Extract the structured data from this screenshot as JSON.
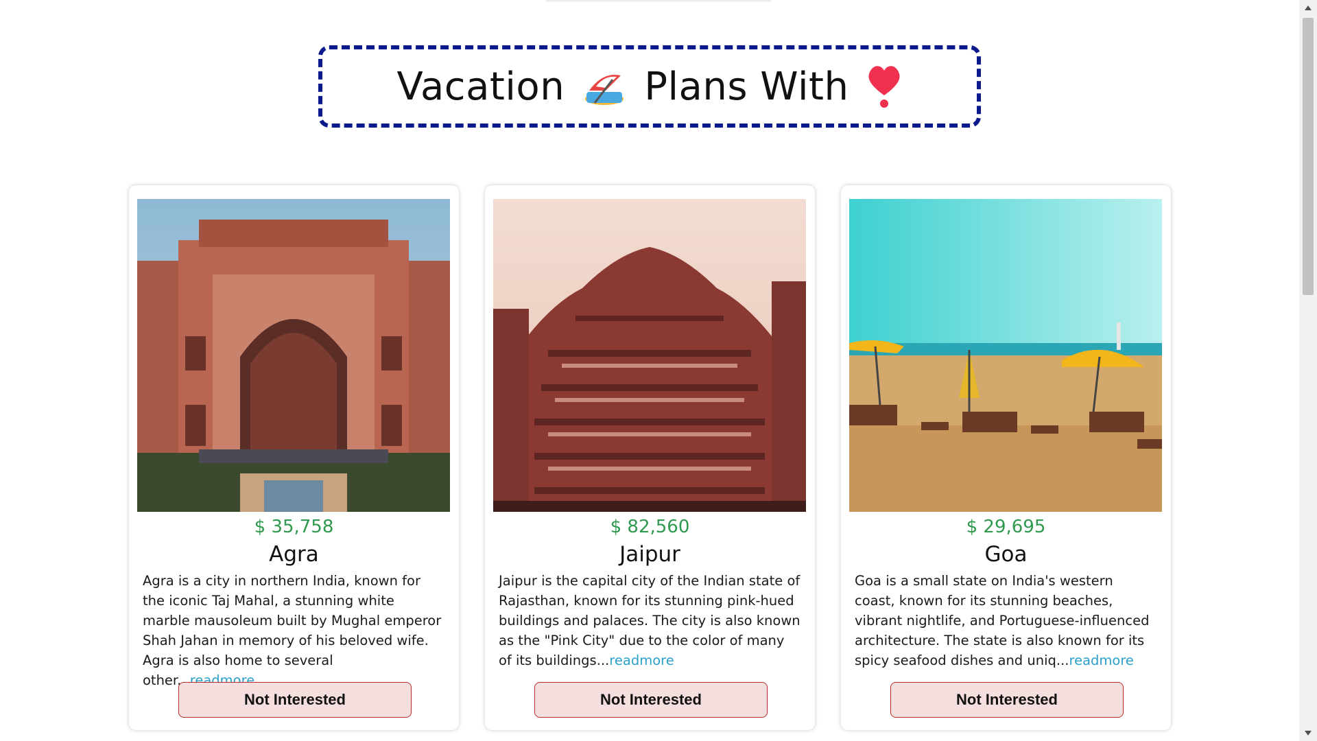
{
  "header": {
    "title_part1": "Vacation",
    "title_part2": "Plans With",
    "umbrella_icon": "beach-umbrella-icon",
    "heart_icon": "heart-exclamation-icon",
    "border_color": "#0a1a8c"
  },
  "cards": [
    {
      "image_icon": "agra-taj-gate-photo",
      "price": "$ 35,758",
      "name": "Agra",
      "description": "Agra is a city in northern India, known for the iconic Taj Mahal, a stunning white marble mausoleum built by Mughal emperor Shah Jahan in memory of his beloved wife. Agra is also home to several other...",
      "readmore": "readmore",
      "button": "Not Interested"
    },
    {
      "image_icon": "jaipur-hawa-mahal-photo",
      "price": "$ 82,560",
      "name": "Jaipur",
      "description": "Jaipur is the capital city of the Indian state of Rajasthan, known for its stunning pink-hued buildings and palaces. The city is also known as the \"Pink City\" due to the color of many of its buildings...",
      "readmore": "readmore",
      "button": "Not Interested"
    },
    {
      "image_icon": "goa-beach-photo",
      "price": "$ 29,695",
      "name": "Goa",
      "description": "Goa is a small state on India's western coast, known for its stunning beaches, vibrant nightlife, and Portuguese-influenced architecture. The state is also known for its spicy seafood dishes and uniq...",
      "readmore": "readmore",
      "button": "Not Interested"
    }
  ],
  "colors": {
    "price": "#2f9a4e",
    "readmore": "#2aa0c9",
    "button_bg": "#f5dede",
    "button_border": "#b22b2b"
  }
}
